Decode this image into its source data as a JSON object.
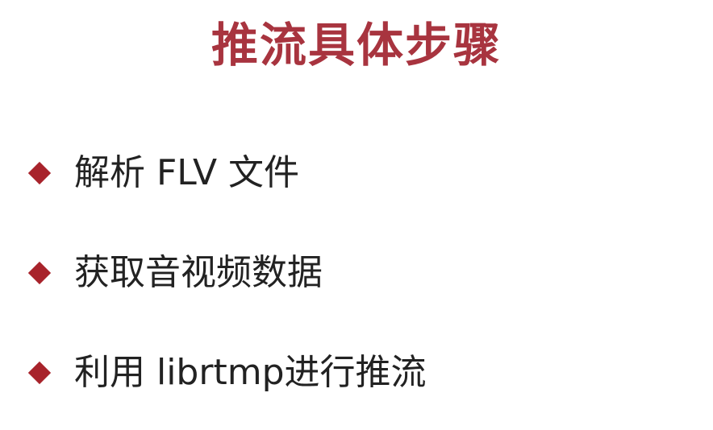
{
  "slide": {
    "title": "推流具体步骤",
    "accent_color": "#a8343f",
    "bullet_color": "#a8232b",
    "bullets": [
      {
        "icon": "diamond-bullet-icon",
        "text": "解析 FLV 文件"
      },
      {
        "icon": "diamond-bullet-icon",
        "text": "获取音视频数据"
      },
      {
        "icon": "diamond-bullet-icon",
        "text": "利用 librtmp进行推流"
      }
    ]
  }
}
